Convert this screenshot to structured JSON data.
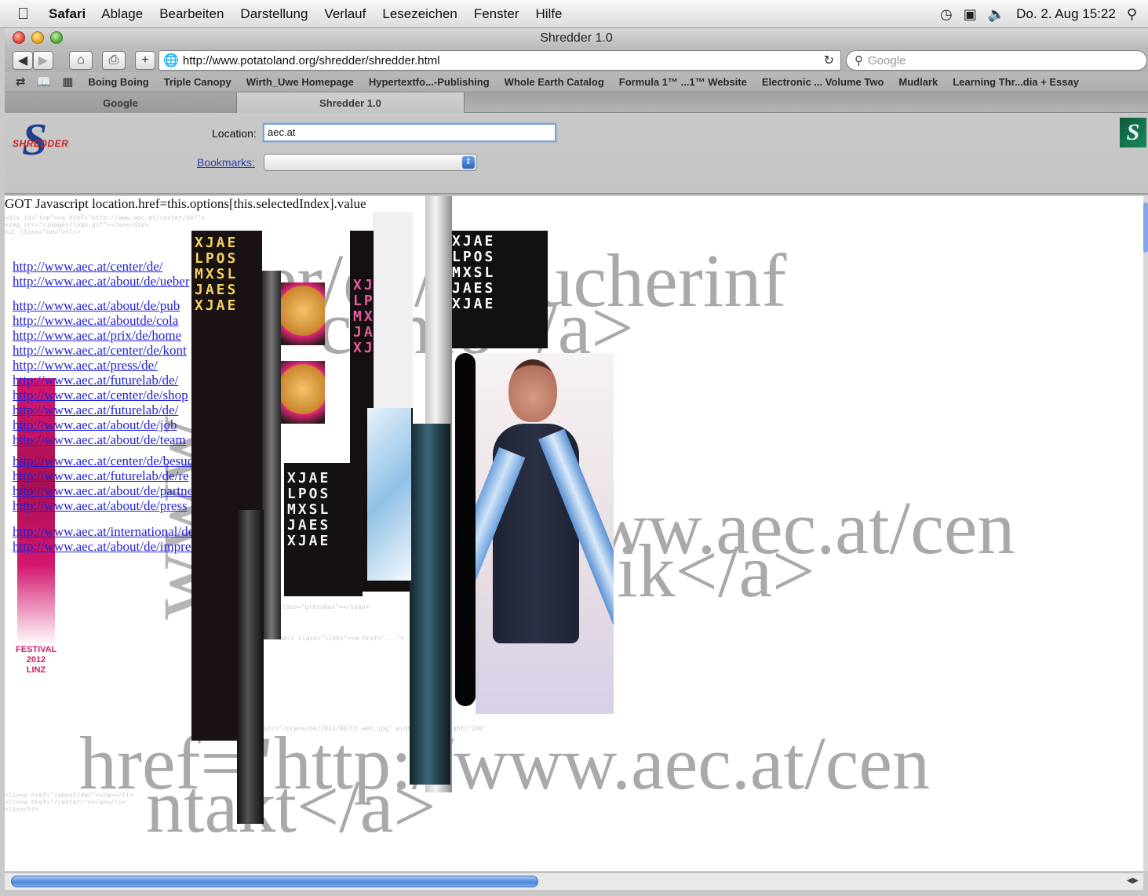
{
  "menubar": {
    "app": "Safari",
    "items": [
      "Ablage",
      "Bearbeiten",
      "Darstellung",
      "Verlauf",
      "Lesezeichen",
      "Fenster",
      "Hilfe"
    ],
    "clock": "Do. 2. Aug 15:22"
  },
  "window": {
    "title": "Shredder 1.0"
  },
  "toolbar": {
    "url": "http://www.potatoland.org/shredder/shredder.html",
    "search_placeholder": "Google"
  },
  "bookmarks": [
    "Boing Boing",
    "Triple Canopy",
    "Wirth_Uwe Homepage",
    "Hypertextfo...-Publishing",
    "Whole Earth Catalog",
    "Formula 1™ ...1™ Website",
    "Electronic ... Volume Two",
    "Mudlark",
    "Learning Thr...dia + Essay"
  ],
  "tabs": [
    "Google",
    "Shredder 1.0"
  ],
  "shredder": {
    "logo_text": "SHREDDER",
    "location_label": "Location:",
    "location_value": "aec.at",
    "bookmarks_label": "Bookmarks:"
  },
  "content": {
    "got_line": "GOT Javascript location.href=this.options[this.selectedIndex].value",
    "big_text_1": "er/de/besucherinf",
    "big_text_2": "c/info</a>",
    "big_text_3": "ww.aec.at/cen",
    "big_text_4": "ik</a>",
    "big_text_5": "href=\"http://www.aec.at/cen",
    "big_text_6": "ntakt</a>",
    "links": [
      "http://www.aec.at/center/de/",
      "http://www.aec.at/about/de/ueber",
      "http://www.aec.at/about/de/pub",
      "http://www.aec.at/aboutde/cola",
      "http://www.aec.at/prix/de/home",
      "http://www.aec.at/center/de/kont",
      "http://www.aec.at/press/de/",
      "http://www.aec.at/futurelab/de/",
      "http://www.aec.at/center/de/shop",
      "http://www.aec.at/futurelab/de/",
      "http://www.aec.at/about/de/job",
      "http://www.aec.at/about/de/team",
      "http://www.aec.at/center/de/besuch",
      "http://www.aec.at/futurelab/de/re",
      "http://www.aec.at/about/de/partner",
      "http://www.aec.at/about/de/press",
      "http://www.aec.at/international/de",
      "http://www.aec.at/about/de/impressum"
    ],
    "letters_block": "XJAE\nLPOS\nMXSL\nJAES\nXJAE"
  },
  "colors": {
    "link": "#1f1fd6",
    "accent": "#d21a6a",
    "scroll": "#4d86dc"
  }
}
